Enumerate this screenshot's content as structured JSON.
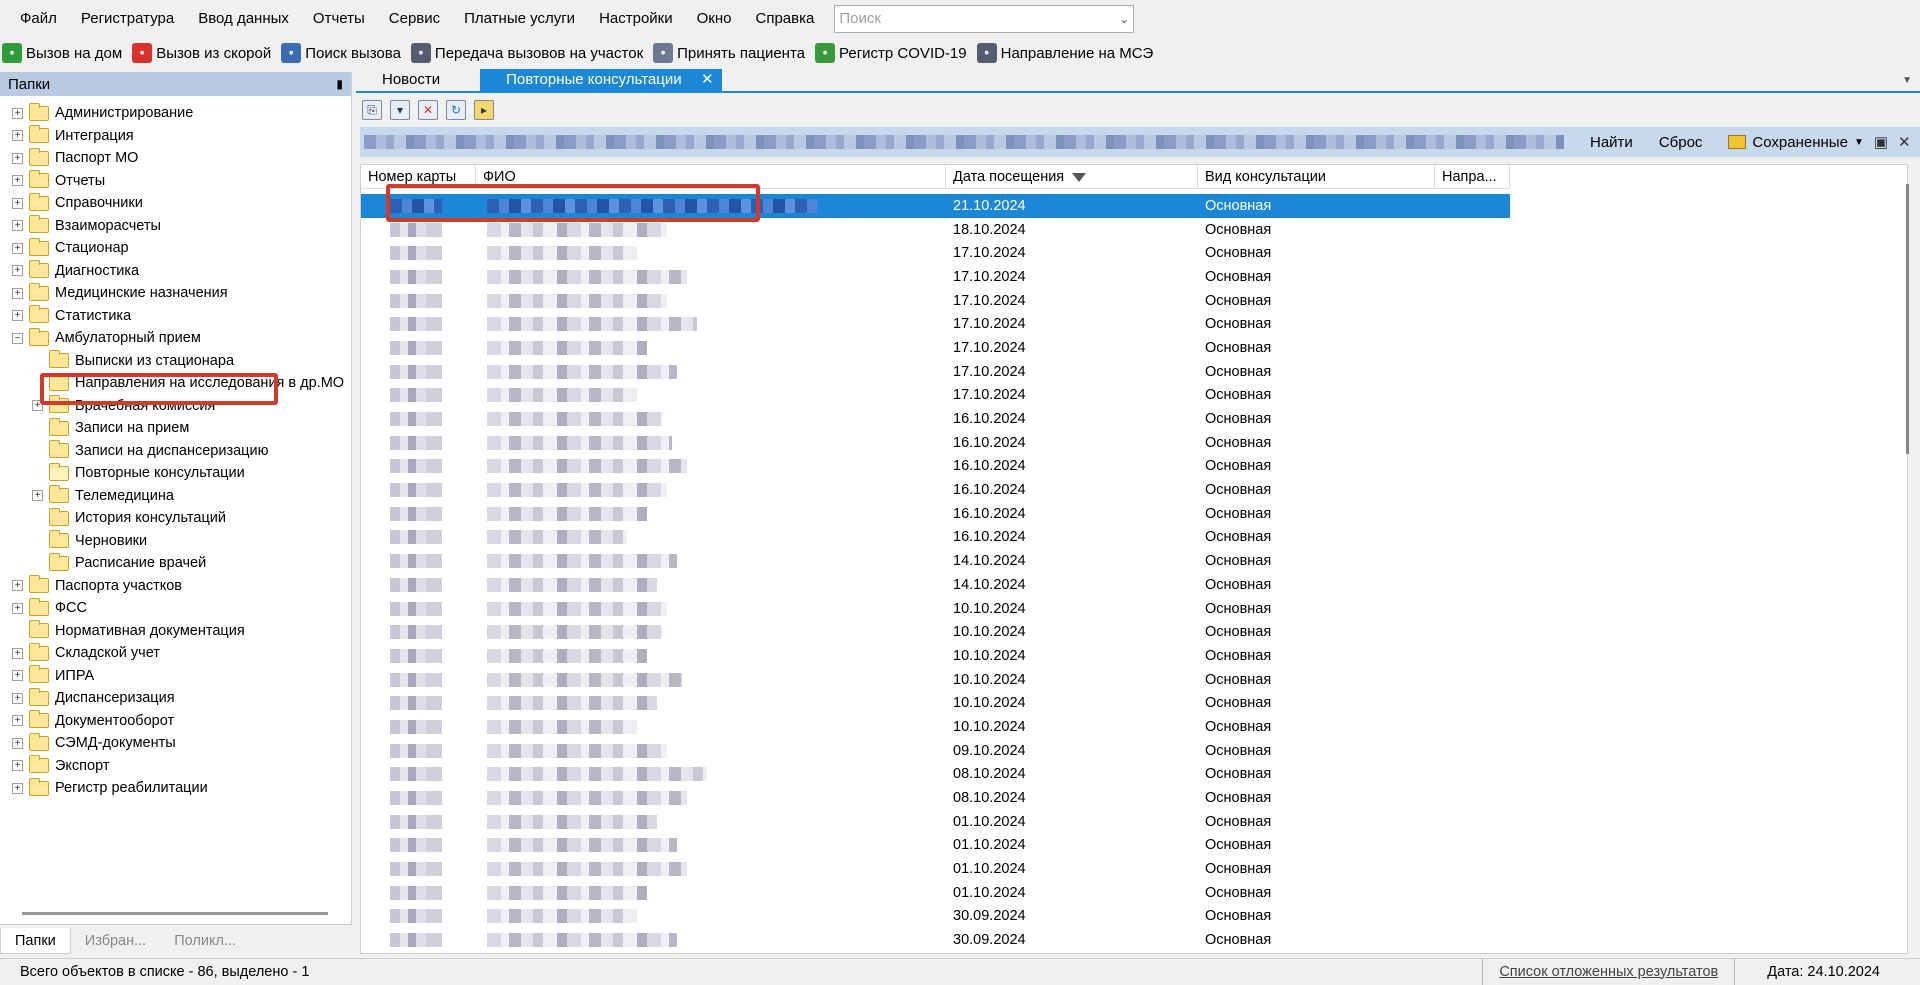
{
  "menu": [
    "Файл",
    "Регистратура",
    "Ввод данных",
    "Отчеты",
    "Сервис",
    "Платные услуги",
    "Настройки",
    "Окно",
    "Справка"
  ],
  "search": {
    "placeholder": "Поиск"
  },
  "toolbar": [
    {
      "label": "Вызов на дом",
      "icon": "check-shield-icon",
      "color": "#2e9c3a"
    },
    {
      "label": "Вызов из скорой",
      "icon": "ambulance-icon",
      "color": "#d8322b"
    },
    {
      "label": "Поиск вызова",
      "icon": "search-icon",
      "color": "#3b6db4"
    },
    {
      "label": "Передача вызовов на участок",
      "icon": "transfer-icon",
      "color": "#555c70"
    },
    {
      "label": "Принять пациента",
      "icon": "patient-icon",
      "color": "#6c7a92"
    },
    {
      "label": "Регистр COVID-19",
      "icon": "virus-icon",
      "color": "#3a9a3a"
    },
    {
      "label": "Направление на МСЭ",
      "icon": "referral-icon",
      "color": "#555c70"
    }
  ],
  "left_panel": {
    "title": "Папки",
    "tree": [
      {
        "label": "Администрирование",
        "level": 0,
        "exp": "+"
      },
      {
        "label": "Интеграция",
        "level": 0,
        "exp": "+"
      },
      {
        "label": "Паспорт МО",
        "level": 0,
        "exp": "+"
      },
      {
        "label": "Отчеты",
        "level": 0,
        "exp": "+"
      },
      {
        "label": "Справочники",
        "level": 0,
        "exp": "+"
      },
      {
        "label": "Взаиморасчеты",
        "level": 0,
        "exp": "+"
      },
      {
        "label": "Стационар",
        "level": 0,
        "exp": "+"
      },
      {
        "label": "Диагностика",
        "level": 0,
        "exp": "+"
      },
      {
        "label": "Медицинские назначения",
        "level": 0,
        "exp": "+"
      },
      {
        "label": "Статистика",
        "level": 0,
        "exp": "+"
      },
      {
        "label": "Амбулаторный прием",
        "level": 0,
        "exp": "-"
      },
      {
        "label": "Выписки из стационара",
        "level": 1,
        "exp": ""
      },
      {
        "label": "Направления на исследования в др.МО",
        "level": 1,
        "exp": ""
      },
      {
        "label": "Врачебная комиссия",
        "level": 1,
        "exp": "+"
      },
      {
        "label": "Записи на прием",
        "level": 1,
        "exp": ""
      },
      {
        "label": "Записи на диспансеризацию",
        "level": 1,
        "exp": ""
      },
      {
        "label": "Повторные консультации",
        "level": 1,
        "exp": "",
        "selected": true
      },
      {
        "label": "Телемедицина",
        "level": 1,
        "exp": "+"
      },
      {
        "label": "История консультаций",
        "level": 1,
        "exp": ""
      },
      {
        "label": "Черновики",
        "level": 1,
        "exp": ""
      },
      {
        "label": "Расписание врачей",
        "level": 1,
        "exp": ""
      },
      {
        "label": "Паспорта участков",
        "level": 0,
        "exp": "+"
      },
      {
        "label": "ФСС",
        "level": 0,
        "exp": "+"
      },
      {
        "label": "Нормативная документация",
        "level": 0,
        "exp": ""
      },
      {
        "label": "Складской учет",
        "level": 0,
        "exp": "+"
      },
      {
        "label": "ИПРА",
        "level": 0,
        "exp": "+"
      },
      {
        "label": "Диспансеризация",
        "level": 0,
        "exp": "+"
      },
      {
        "label": "Документооборот",
        "level": 0,
        "exp": "+"
      },
      {
        "label": "СЭМД-документы",
        "level": 0,
        "exp": "+"
      },
      {
        "label": "Экспорт",
        "level": 0,
        "exp": "+"
      },
      {
        "label": "Регистр реабилитации",
        "level": 0,
        "exp": "+"
      }
    ],
    "tabs": [
      "Папки",
      "Избран...",
      "Поликл..."
    ]
  },
  "doc_tabs": {
    "inactive": "Новости",
    "active": "Повторные консультации",
    "close": "✕"
  },
  "filterbar": {
    "find": "Найти",
    "reset": "Сброс",
    "saved": "Сохраненные",
    "close": "✕"
  },
  "grid": {
    "columns": [
      "Номер карты",
      "ФИО",
      "Дата посещения",
      "Вид консультации",
      "Напра..."
    ],
    "rows": [
      {
        "date": "21.10.2024",
        "type": "Основная",
        "selected": true,
        "fio_w": 0
      },
      {
        "date": "18.10.2024",
        "type": "Основная",
        "fio_w": 180
      },
      {
        "date": "17.10.2024",
        "type": "Основная",
        "fio_w": 150
      },
      {
        "date": "17.10.2024",
        "type": "Основная",
        "fio_w": 200
      },
      {
        "date": "17.10.2024",
        "type": "Основная",
        "fio_w": 180
      },
      {
        "date": "17.10.2024",
        "type": "Основная",
        "fio_w": 210
      },
      {
        "date": "17.10.2024",
        "type": "Основная",
        "fio_w": 160
      },
      {
        "date": "17.10.2024",
        "type": "Основная",
        "fio_w": 190
      },
      {
        "date": "17.10.2024",
        "type": "Основная",
        "fio_w": 150
      },
      {
        "date": "16.10.2024",
        "type": "Основная",
        "fio_w": 175
      },
      {
        "date": "16.10.2024",
        "type": "Основная",
        "fio_w": 185
      },
      {
        "date": "16.10.2024",
        "type": "Основная",
        "fio_w": 200
      },
      {
        "date": "16.10.2024",
        "type": "Основная",
        "fio_w": 180
      },
      {
        "date": "16.10.2024",
        "type": "Основная",
        "fio_w": 160
      },
      {
        "date": "16.10.2024",
        "type": "Основная",
        "fio_w": 140
      },
      {
        "date": "14.10.2024",
        "type": "Основная",
        "fio_w": 190
      },
      {
        "date": "14.10.2024",
        "type": "Основная",
        "fio_w": 170
      },
      {
        "date": "10.10.2024",
        "type": "Основная",
        "fio_w": 180
      },
      {
        "date": "10.10.2024",
        "type": "Основная",
        "fio_w": 175
      },
      {
        "date": "10.10.2024",
        "type": "Основная",
        "fio_w": 160
      },
      {
        "date": "10.10.2024",
        "type": "Основная",
        "fio_w": 195
      },
      {
        "date": "10.10.2024",
        "type": "Основная",
        "fio_w": 170
      },
      {
        "date": "10.10.2024",
        "type": "Основная",
        "fio_w": 150
      },
      {
        "date": "09.10.2024",
        "type": "Основная",
        "fio_w": 180
      },
      {
        "date": "08.10.2024",
        "type": "Основная",
        "fio_w": 220
      },
      {
        "date": "08.10.2024",
        "type": "Основная",
        "fio_w": 200
      },
      {
        "date": "01.10.2024",
        "type": "Основная",
        "fio_w": 170
      },
      {
        "date": "01.10.2024",
        "type": "Основная",
        "fio_w": 190
      },
      {
        "date": "01.10.2024",
        "type": "Основная",
        "fio_w": 200
      },
      {
        "date": "01.10.2024",
        "type": "Основная",
        "fio_w": 160
      },
      {
        "date": "30.09.2024",
        "type": "Основная",
        "fio_w": 150
      },
      {
        "date": "30.09.2024",
        "type": "Основная",
        "fio_w": 190
      }
    ]
  },
  "status": {
    "count": "Всего объектов в списке - 86, выделено - 1",
    "deferred": "Список отложенных результатов",
    "date": "Дата: 24.10.2024"
  }
}
